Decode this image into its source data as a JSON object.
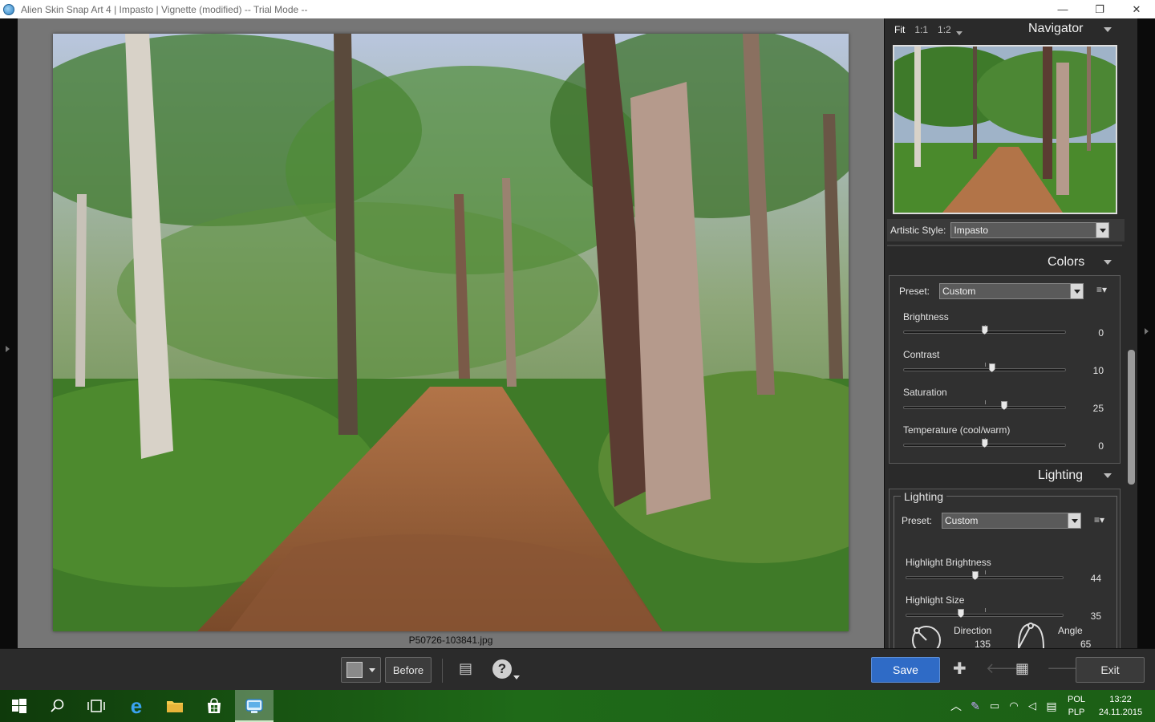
{
  "window": {
    "title": "Alien Skin Snap Art 4 | Impasto | Vignette (modified) -- Trial Mode --",
    "minimize_glyph": "—",
    "maximize_glyph": "❐",
    "close_glyph": "✕"
  },
  "canvas": {
    "filename": "P50726-103841.jpg"
  },
  "navigator": {
    "zoom_options": [
      "Fit",
      "1:1",
      "1:2"
    ],
    "title": "Navigator"
  },
  "artistic_style": {
    "label": "Artistic Style:",
    "value": "Impasto"
  },
  "colors": {
    "title": "Colors",
    "preset_label": "Preset:",
    "preset_value": "Custom",
    "sliders": [
      {
        "label": "Brightness",
        "value": "0",
        "level": 0.5
      },
      {
        "label": "Contrast",
        "value": "10",
        "level": 0.545
      },
      {
        "label": "Saturation",
        "value": "25",
        "level": 0.62
      },
      {
        "label": "Temperature (cool/warm)",
        "value": "0",
        "level": 0.5
      }
    ]
  },
  "lighting": {
    "title": "Lighting",
    "group_label": "Lighting",
    "preset_label": "Preset:",
    "preset_value": "Custom",
    "sliders": [
      {
        "label": "Highlight Brightness",
        "value": "44",
        "level": 0.44
      },
      {
        "label": "Highlight Size",
        "value": "35",
        "level": 0.35
      }
    ],
    "direction_label": "Direction",
    "direction_value": "135",
    "angle_label": "Angle",
    "angle_value": "65"
  },
  "toolbar": {
    "before_label": "Before",
    "save_label": "Save",
    "exit_label": "Exit",
    "help_glyph": "?",
    "add_glyph": "✚"
  },
  "taskbar": {
    "lang_top": "POL",
    "lang_bottom": "PLP",
    "time": "13:22",
    "date": "24.11.2015"
  }
}
